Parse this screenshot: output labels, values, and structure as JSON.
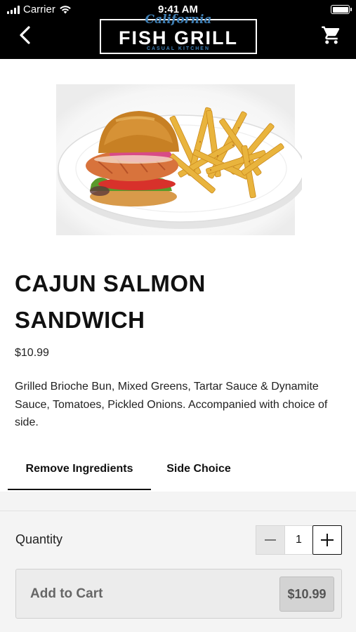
{
  "status_bar": {
    "carrier": "Carrier",
    "time": "9:41 AM"
  },
  "header": {
    "logo": {
      "script_text": "California",
      "main_text": "FISH GRILL",
      "sub_text": "CASUAL KITCHEN"
    },
    "back_icon": "chevron-left-icon",
    "cart_icon": "shopping-cart-icon"
  },
  "product": {
    "image_icon": "cajun-salmon-sandwich-with-fries",
    "title": "CAJUN SALMON SANDWICH",
    "price": "$10.99",
    "description": "Grilled Brioche Bun, Mixed Greens, Tartar Sauce & Dynamite Sauce, Tomatoes, Pickled Onions. Accompanied with choice of side."
  },
  "tabs": [
    {
      "label": "Remove Ingredients",
      "active": true
    },
    {
      "label": "Side Choice",
      "active": false
    }
  ],
  "order": {
    "quantity_label": "Quantity",
    "quantity_value": "1",
    "add_to_cart_label": "Add to Cart",
    "add_to_cart_price": "$10.99"
  },
  "colors": {
    "header_bg": "#000000",
    "logo_accent": "#3f7fb4",
    "panel_bg": "#f4f4f4",
    "button_bg": "#ececec"
  }
}
